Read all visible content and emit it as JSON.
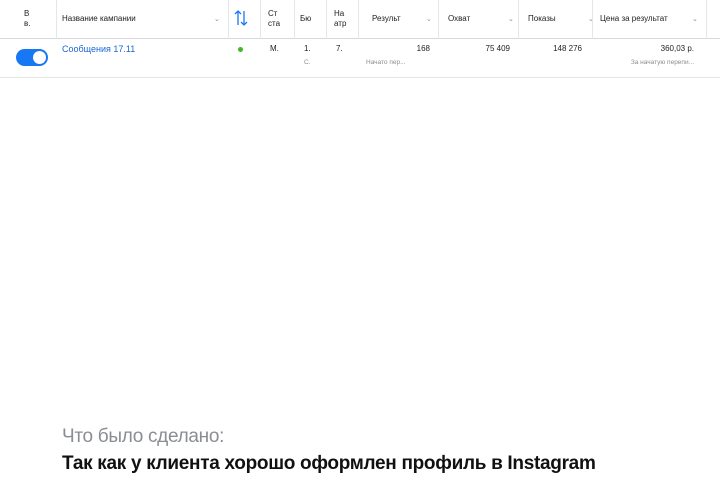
{
  "table": {
    "headers": {
      "delivery": "В в.",
      "campaign_name": "Название кампании",
      "attention": "",
      "status": "Ст ста",
      "budget": "Бю",
      "attribution": "На атр",
      "results": "Результ",
      "reach": "Охват",
      "impressions": "Показы",
      "cost_per_result": "Цена за результат"
    },
    "row": {
      "campaign": "Сообщения 17.11",
      "status_short": "М.",
      "budget_short": "1.",
      "budget_sub": "С.",
      "attribution_short": "7.",
      "results": "168",
      "results_sub": "Начато пер...",
      "reach": "75 409",
      "impressions": "148 276",
      "cost": "360,03 р.",
      "cost_sub": "За начатую перепи..."
    },
    "toggle_on": true,
    "status_color": "#42b72a",
    "accent": "#1877f2"
  },
  "article": {
    "caption": "Что было сделано:",
    "lead": "Так как у клиента хорошо оформлен профиль в Instagram"
  }
}
